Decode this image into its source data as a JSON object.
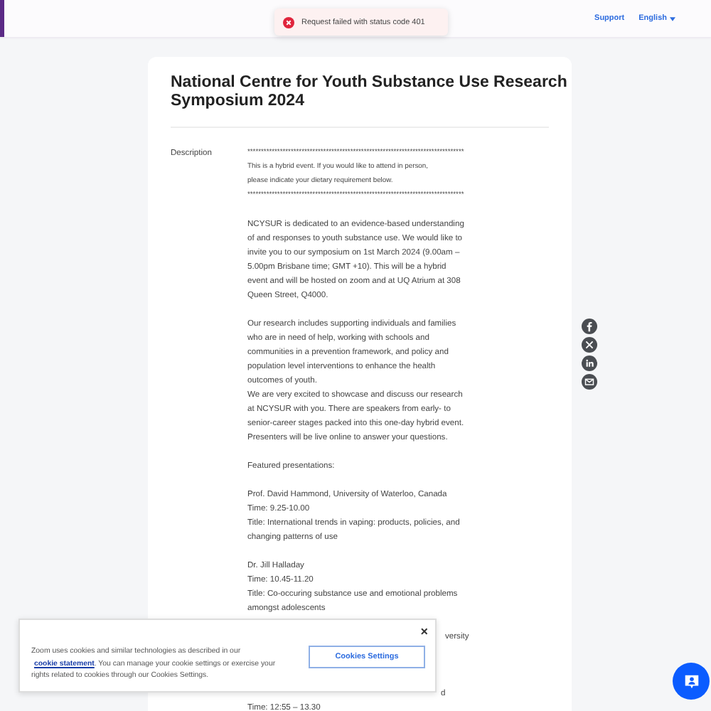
{
  "header": {
    "links": [
      {
        "label": "Support",
        "kind": "link"
      },
      {
        "label": "English",
        "kind": "dropdown"
      }
    ]
  },
  "toast": {
    "message": "Request failed with status code 401"
  },
  "event": {
    "title": "National Centre for Youth Substance Use Research Symposium 2024",
    "description_label": "Description",
    "paragraphs": [
      {
        "lines": [
          "********************************************************************************",
          "This is a hybrid event. If you would like to attend in person,",
          "please  indicate your dietary requirement below.",
          "********************************************************************************"
        ]
      },
      {
        "lines": [
          "NCYSUR is dedicated to an evidence-based understanding",
          "of and responses to youth substance use. We would like to",
          "invite you to our symposium on 1st March 2024 (9.00am –",
          "5.00pm Brisbane time; GMT +10). This will be a hybrid",
          "event and will be hosted on zoom and at UQ Atrium at 308",
          "Queen Street, Q4000."
        ]
      },
      {
        "lines": [
          "Our research includes supporting individuals and families",
          "who are in need of help, working with schools and",
          "communities in a prevention framework, and policy and",
          "population level interventions to enhance the health",
          "outcomes of youth.",
          "We are very excited to showcase and discuss our research",
          "at NCYSUR with you. There are speakers from early- to",
          "senior-career stages packed into this one-day hybrid event.",
          "Presenters will be live online to answer your questions."
        ]
      },
      {
        "lines": [
          "Featured presentations:"
        ]
      },
      {
        "lines": [
          "Prof. David Hammond, University of Waterloo, Canada",
          "Time: 9.25-10.00",
          "Title: International trends in vaping: products, policies, and",
          "changing patterns of use"
        ]
      },
      {
        "lines": [
          "Dr. Jill Halladay",
          "Time: 10.45-11.20",
          "Title: Co-occuring substance use and emotional problems",
          "amongst adolescents"
        ]
      }
    ],
    "covered_fragments": [
      "versity",
      "d"
    ],
    "after_banner": "Time: 12:55 – 13.30"
  },
  "share_icons": [
    {
      "kind": "facebook"
    },
    {
      "kind": "x"
    },
    {
      "kind": "linkedin"
    },
    {
      "kind": "email"
    }
  ],
  "cookie_banner": {
    "text_before": "Zoom uses cookies and similar technologies as described in our",
    "link": "cookie statement",
    "text_after": ". You can manage your cookie settings or exercise your rights related to cookies through our Cookies Settings.",
    "button": "Cookies Settings",
    "close": "×"
  }
}
